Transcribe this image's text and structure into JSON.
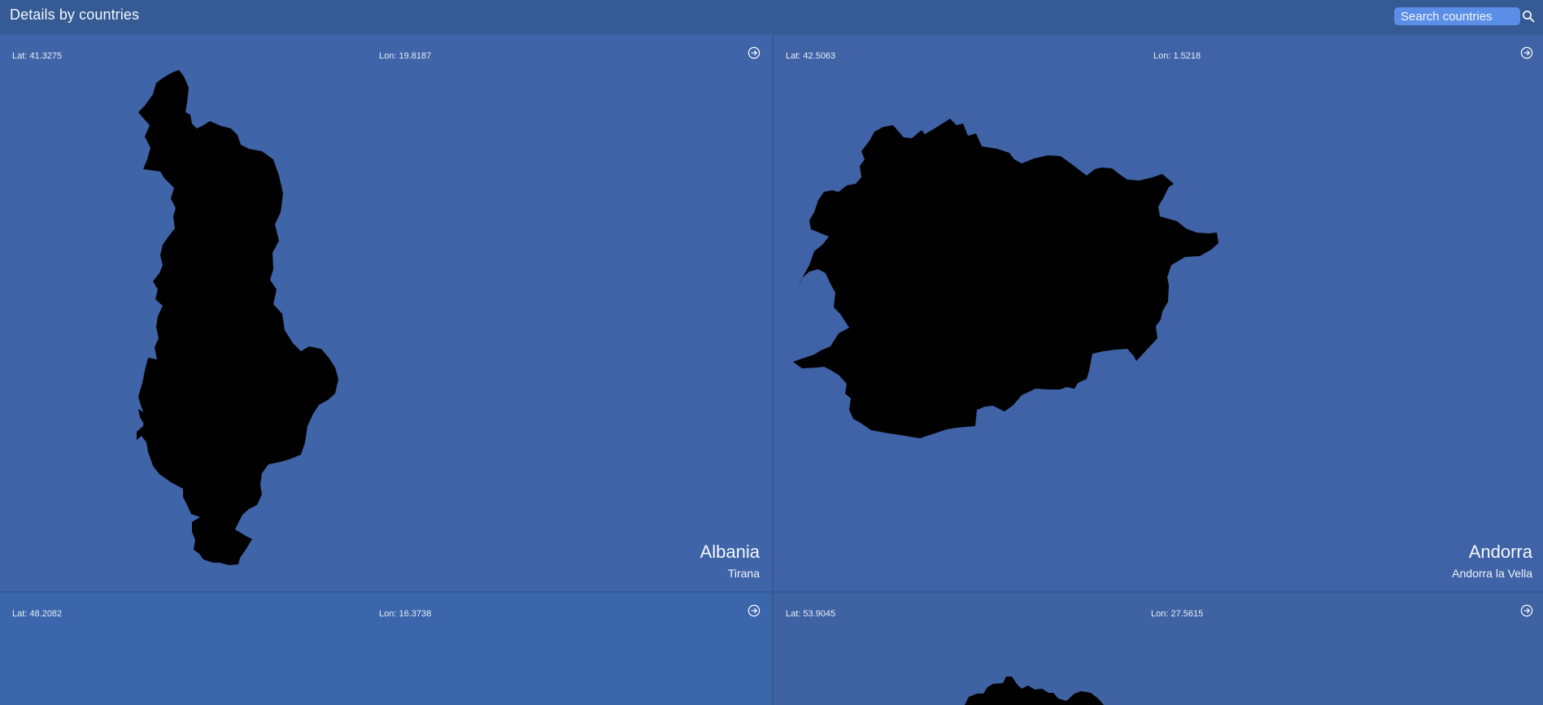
{
  "header": {
    "title": "Details by countries",
    "search_placeholder": "Search countries"
  },
  "icons": {
    "search": "search-icon",
    "open_details": "arrow-circle-right-icon"
  },
  "colors": {
    "background": "#355a94",
    "search_field": "#5b8ee6",
    "country_shape": "#000000",
    "text": "#ffffff"
  },
  "countries": [
    {
      "lat_label": "Lat: 41.3275",
      "lon_label": "Lon: 19.8187",
      "name": "Albania",
      "capital": "Tirana"
    },
    {
      "lat_label": "Lat: 42.5063",
      "lon_label": "Lon: 1.5218",
      "name": "Andorra",
      "capital": "Andorra la Vella"
    },
    {
      "lat_label": "Lat: 48.2082",
      "lon_label": "Lon: 16.3738",
      "name": "",
      "capital": ""
    },
    {
      "lat_label": "Lat: 53.9045",
      "lon_label": "Lon: 27.5615",
      "name": "",
      "capital": ""
    }
  ]
}
